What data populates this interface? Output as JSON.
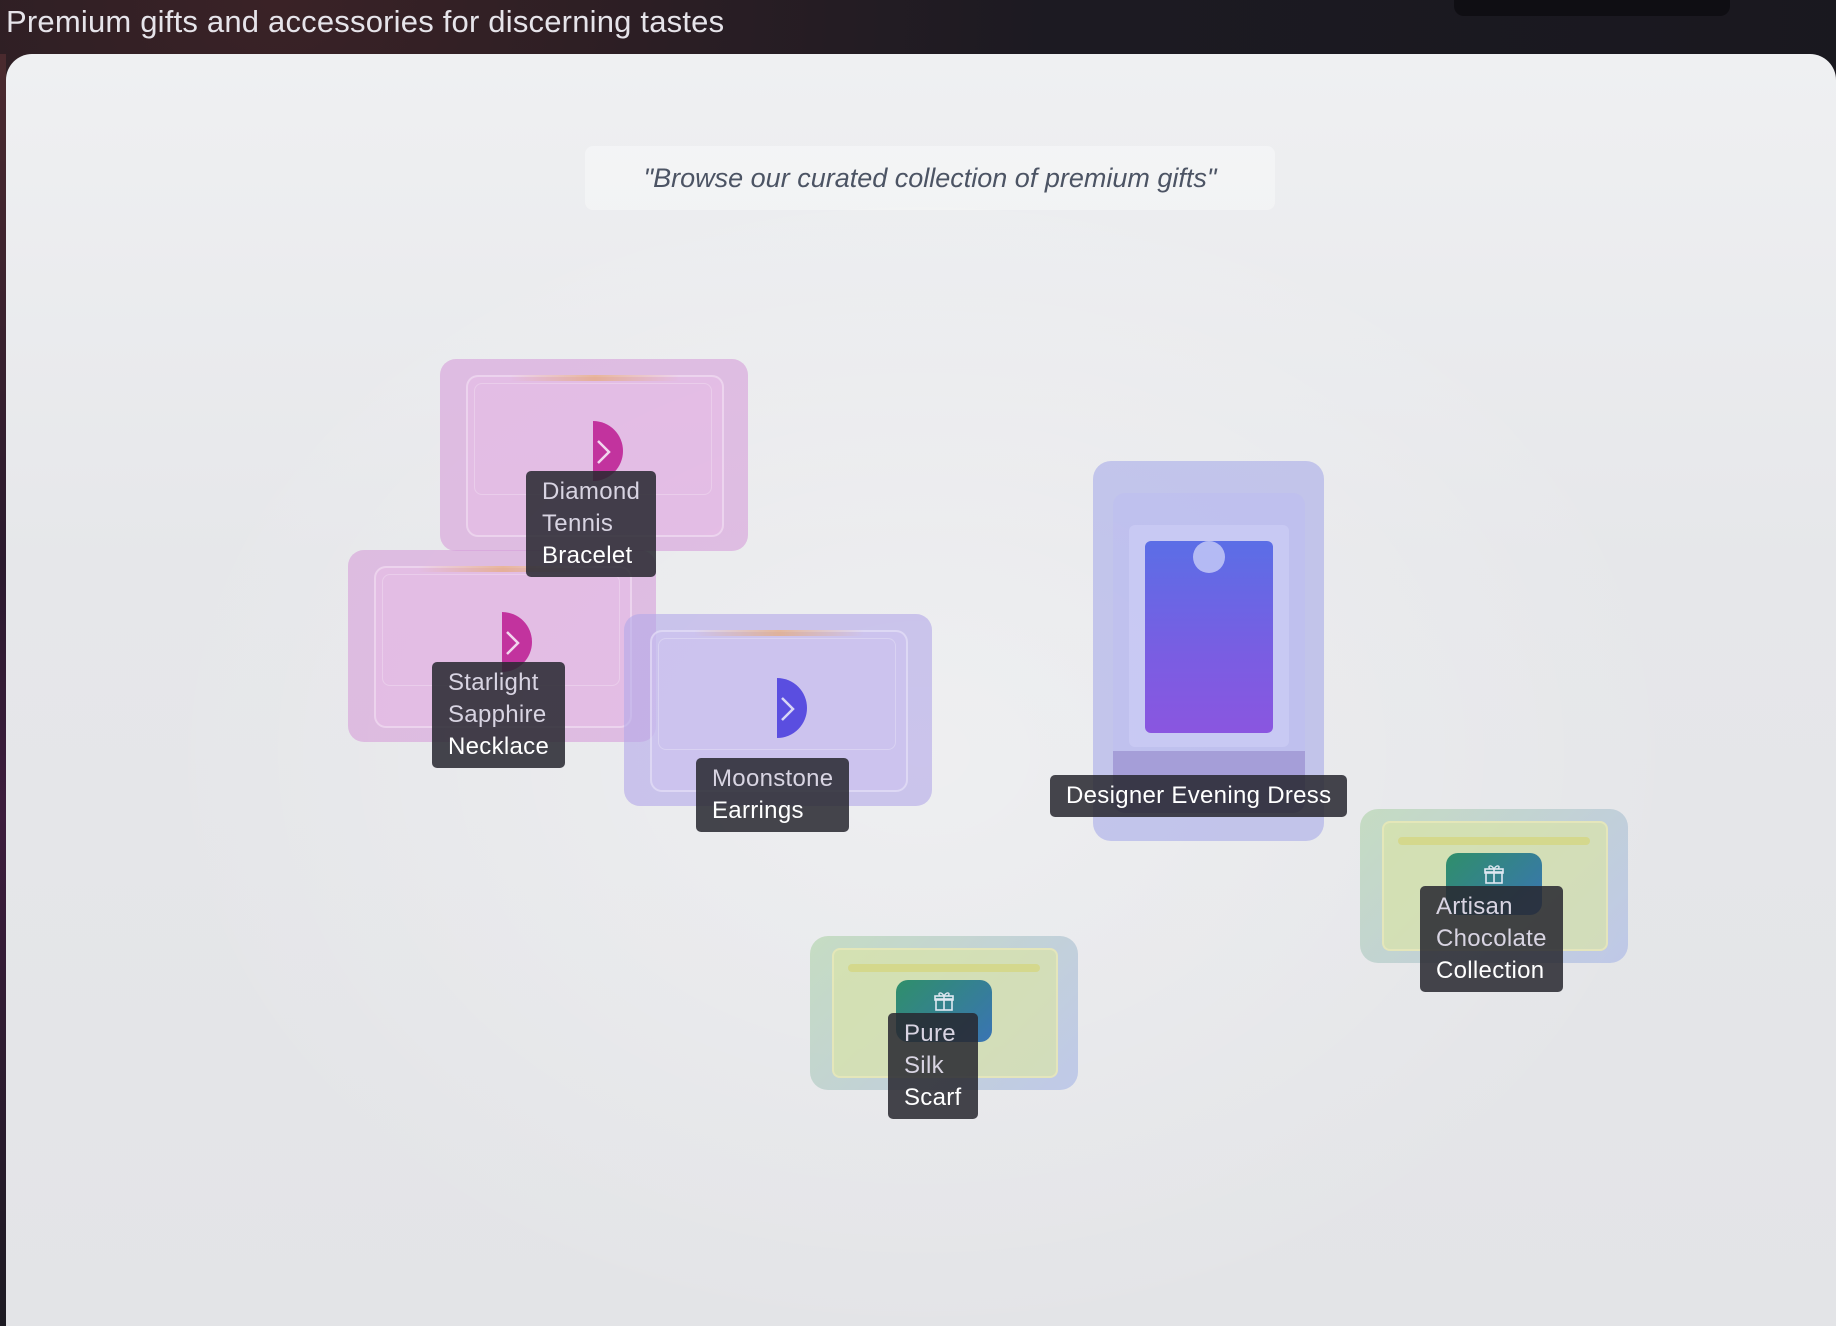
{
  "header": {
    "tagline": "Premium gifts and accessories for discerning tastes"
  },
  "main": {
    "quote": "\"Browse our curated collection of premium gifts\""
  },
  "products": [
    {
      "name_l1": "Diamond",
      "name_l2": "Tennis",
      "name_l3": "Bracelet",
      "icon": "chevron-right-icon"
    },
    {
      "name_l1": "Starlight",
      "name_l2": "Sapphire",
      "name_l3": "Necklace",
      "icon": "chevron-right-icon"
    },
    {
      "name_l1": "Moonstone",
      "name_l2": "Earrings",
      "icon": "chevron-right-icon"
    },
    {
      "name": "Designer Evening Dress",
      "icon": "phone-frame-icon"
    },
    {
      "name_l1": "Artisan",
      "name_l2": "Chocolate",
      "name_l3": "Collection",
      "icon": "gift-icon"
    },
    {
      "name_l1": "Pure",
      "name_l2": "Silk",
      "name_l3": "Scarf",
      "icon": "gift-icon"
    }
  ],
  "colors": {
    "pink_accent": "#c2339e",
    "purple_accent": "#5a4ee0",
    "label_bg": "#2a2a30",
    "gift_icon": "#2f8f6a"
  }
}
